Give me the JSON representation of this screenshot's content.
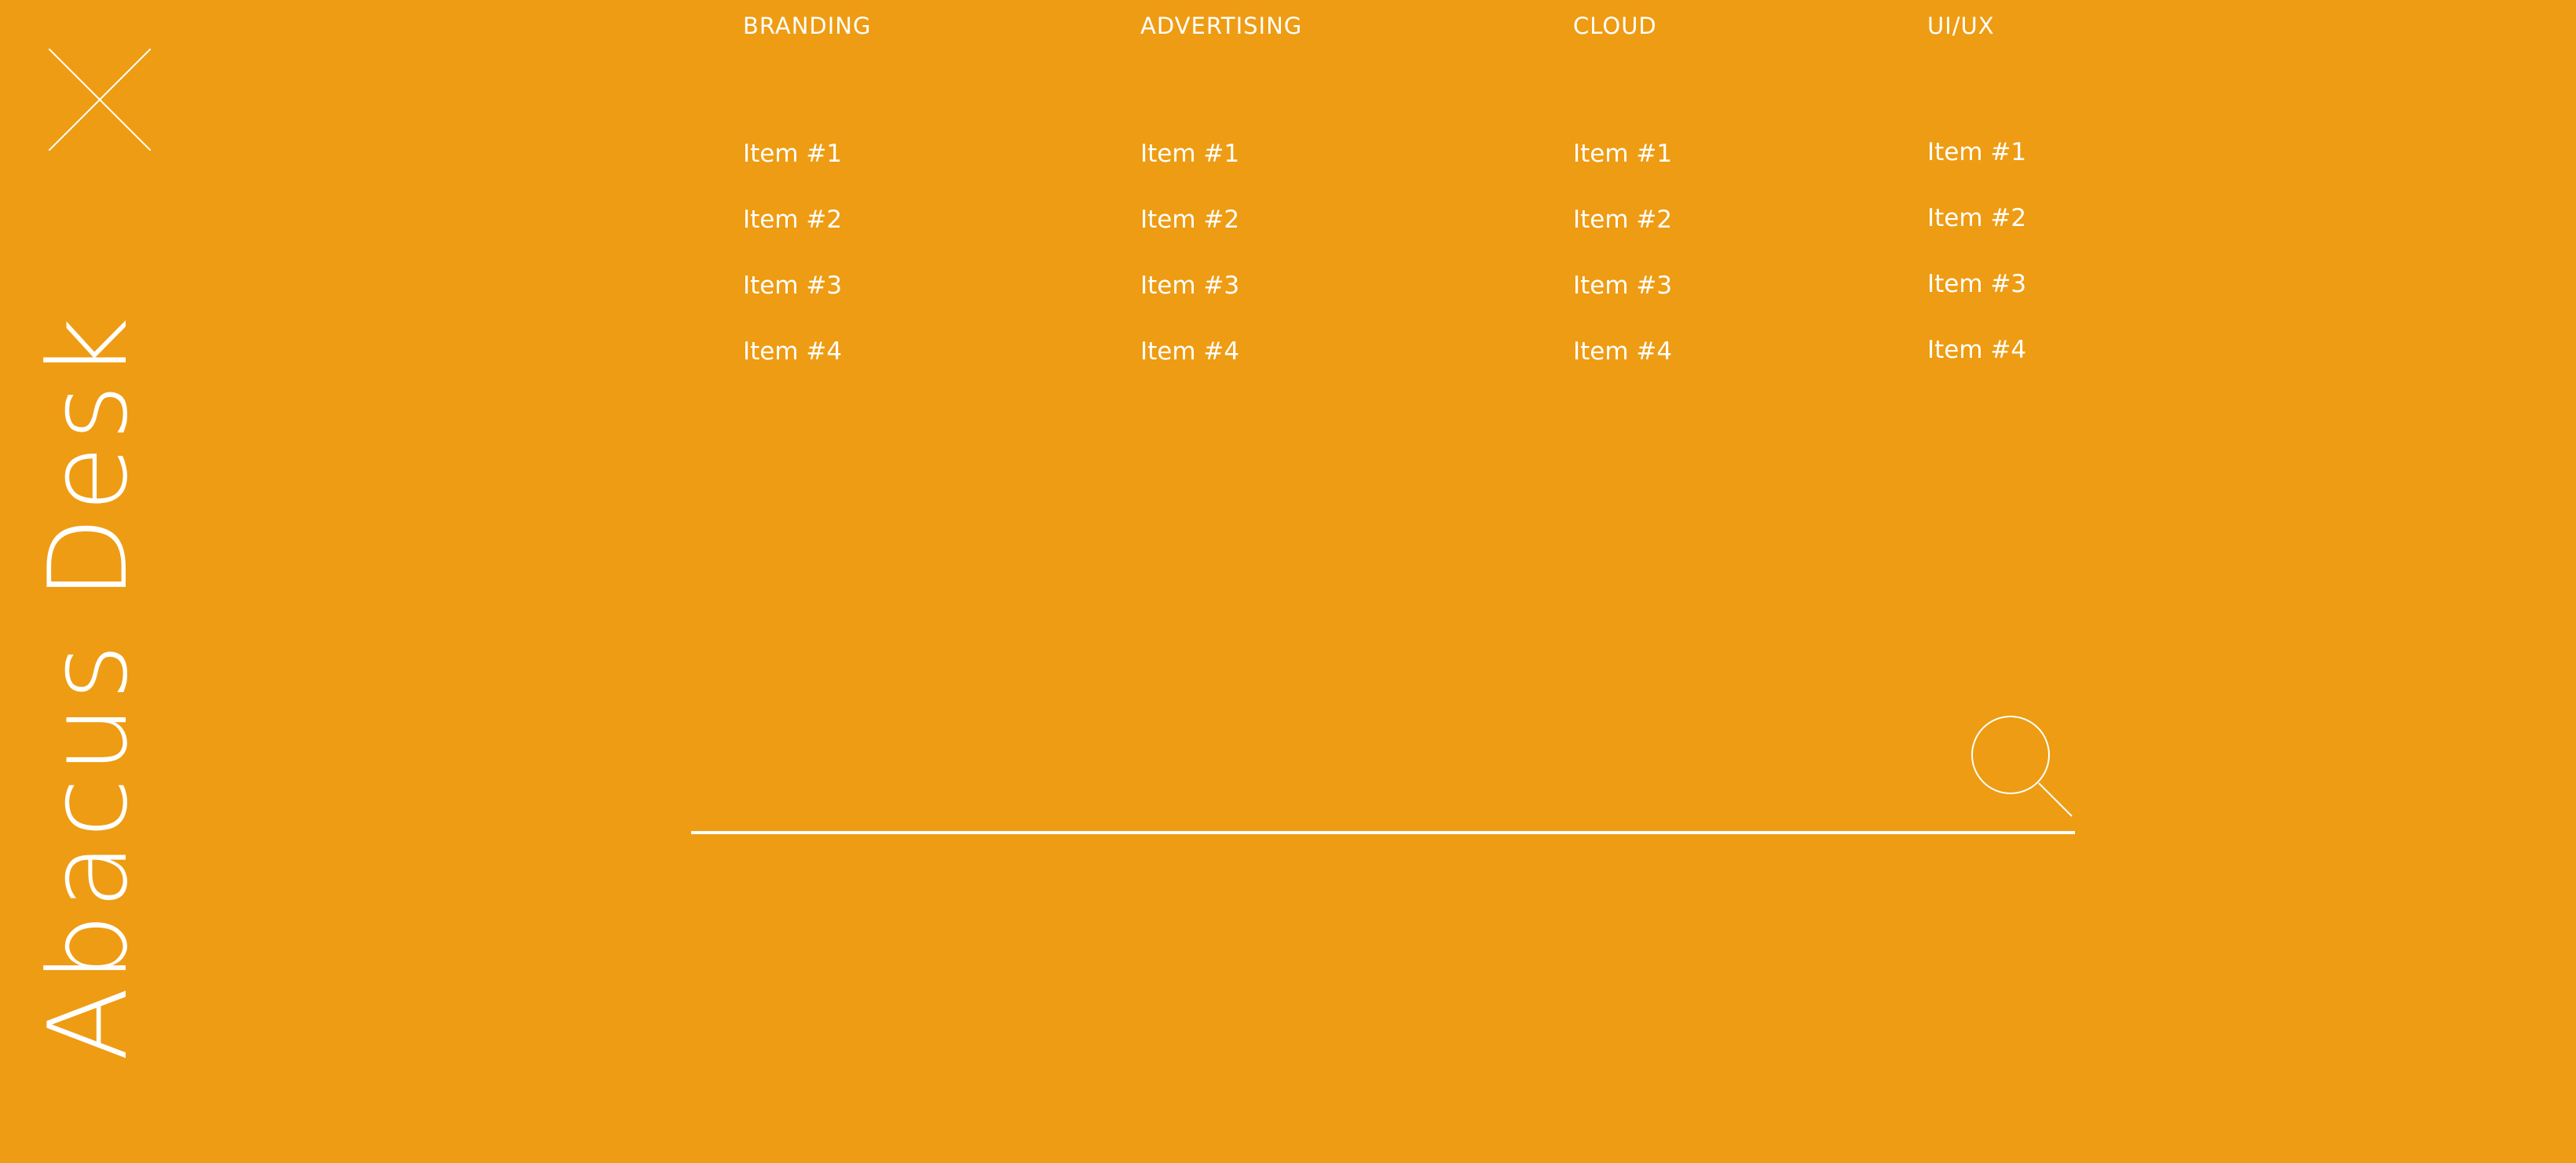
{
  "brand": {
    "title": "Abacus Desk"
  },
  "close": {
    "icon": "close-icon"
  },
  "menu": {
    "columns": [
      {
        "heading": "BRANDING",
        "items": [
          "Item #1",
          "Item #2",
          "Item #3",
          "Item #4"
        ]
      },
      {
        "heading": "ADVERTISING",
        "items": [
          "Item #1",
          "Item #2",
          "Item #3",
          "Item #4"
        ]
      },
      {
        "heading": "CLOUD",
        "items": [
          "Item #1",
          "Item #2",
          "Item #3",
          "Item #4"
        ]
      },
      {
        "heading": "UI/UX",
        "items": [
          "Item #1",
          "Item #2",
          "Item #3",
          "Item #4"
        ]
      }
    ]
  },
  "search": {
    "value": "",
    "placeholder": "",
    "icon": "search-icon"
  },
  "colors": {
    "background": "#EE9C13",
    "foreground": "#FFFFFF"
  }
}
